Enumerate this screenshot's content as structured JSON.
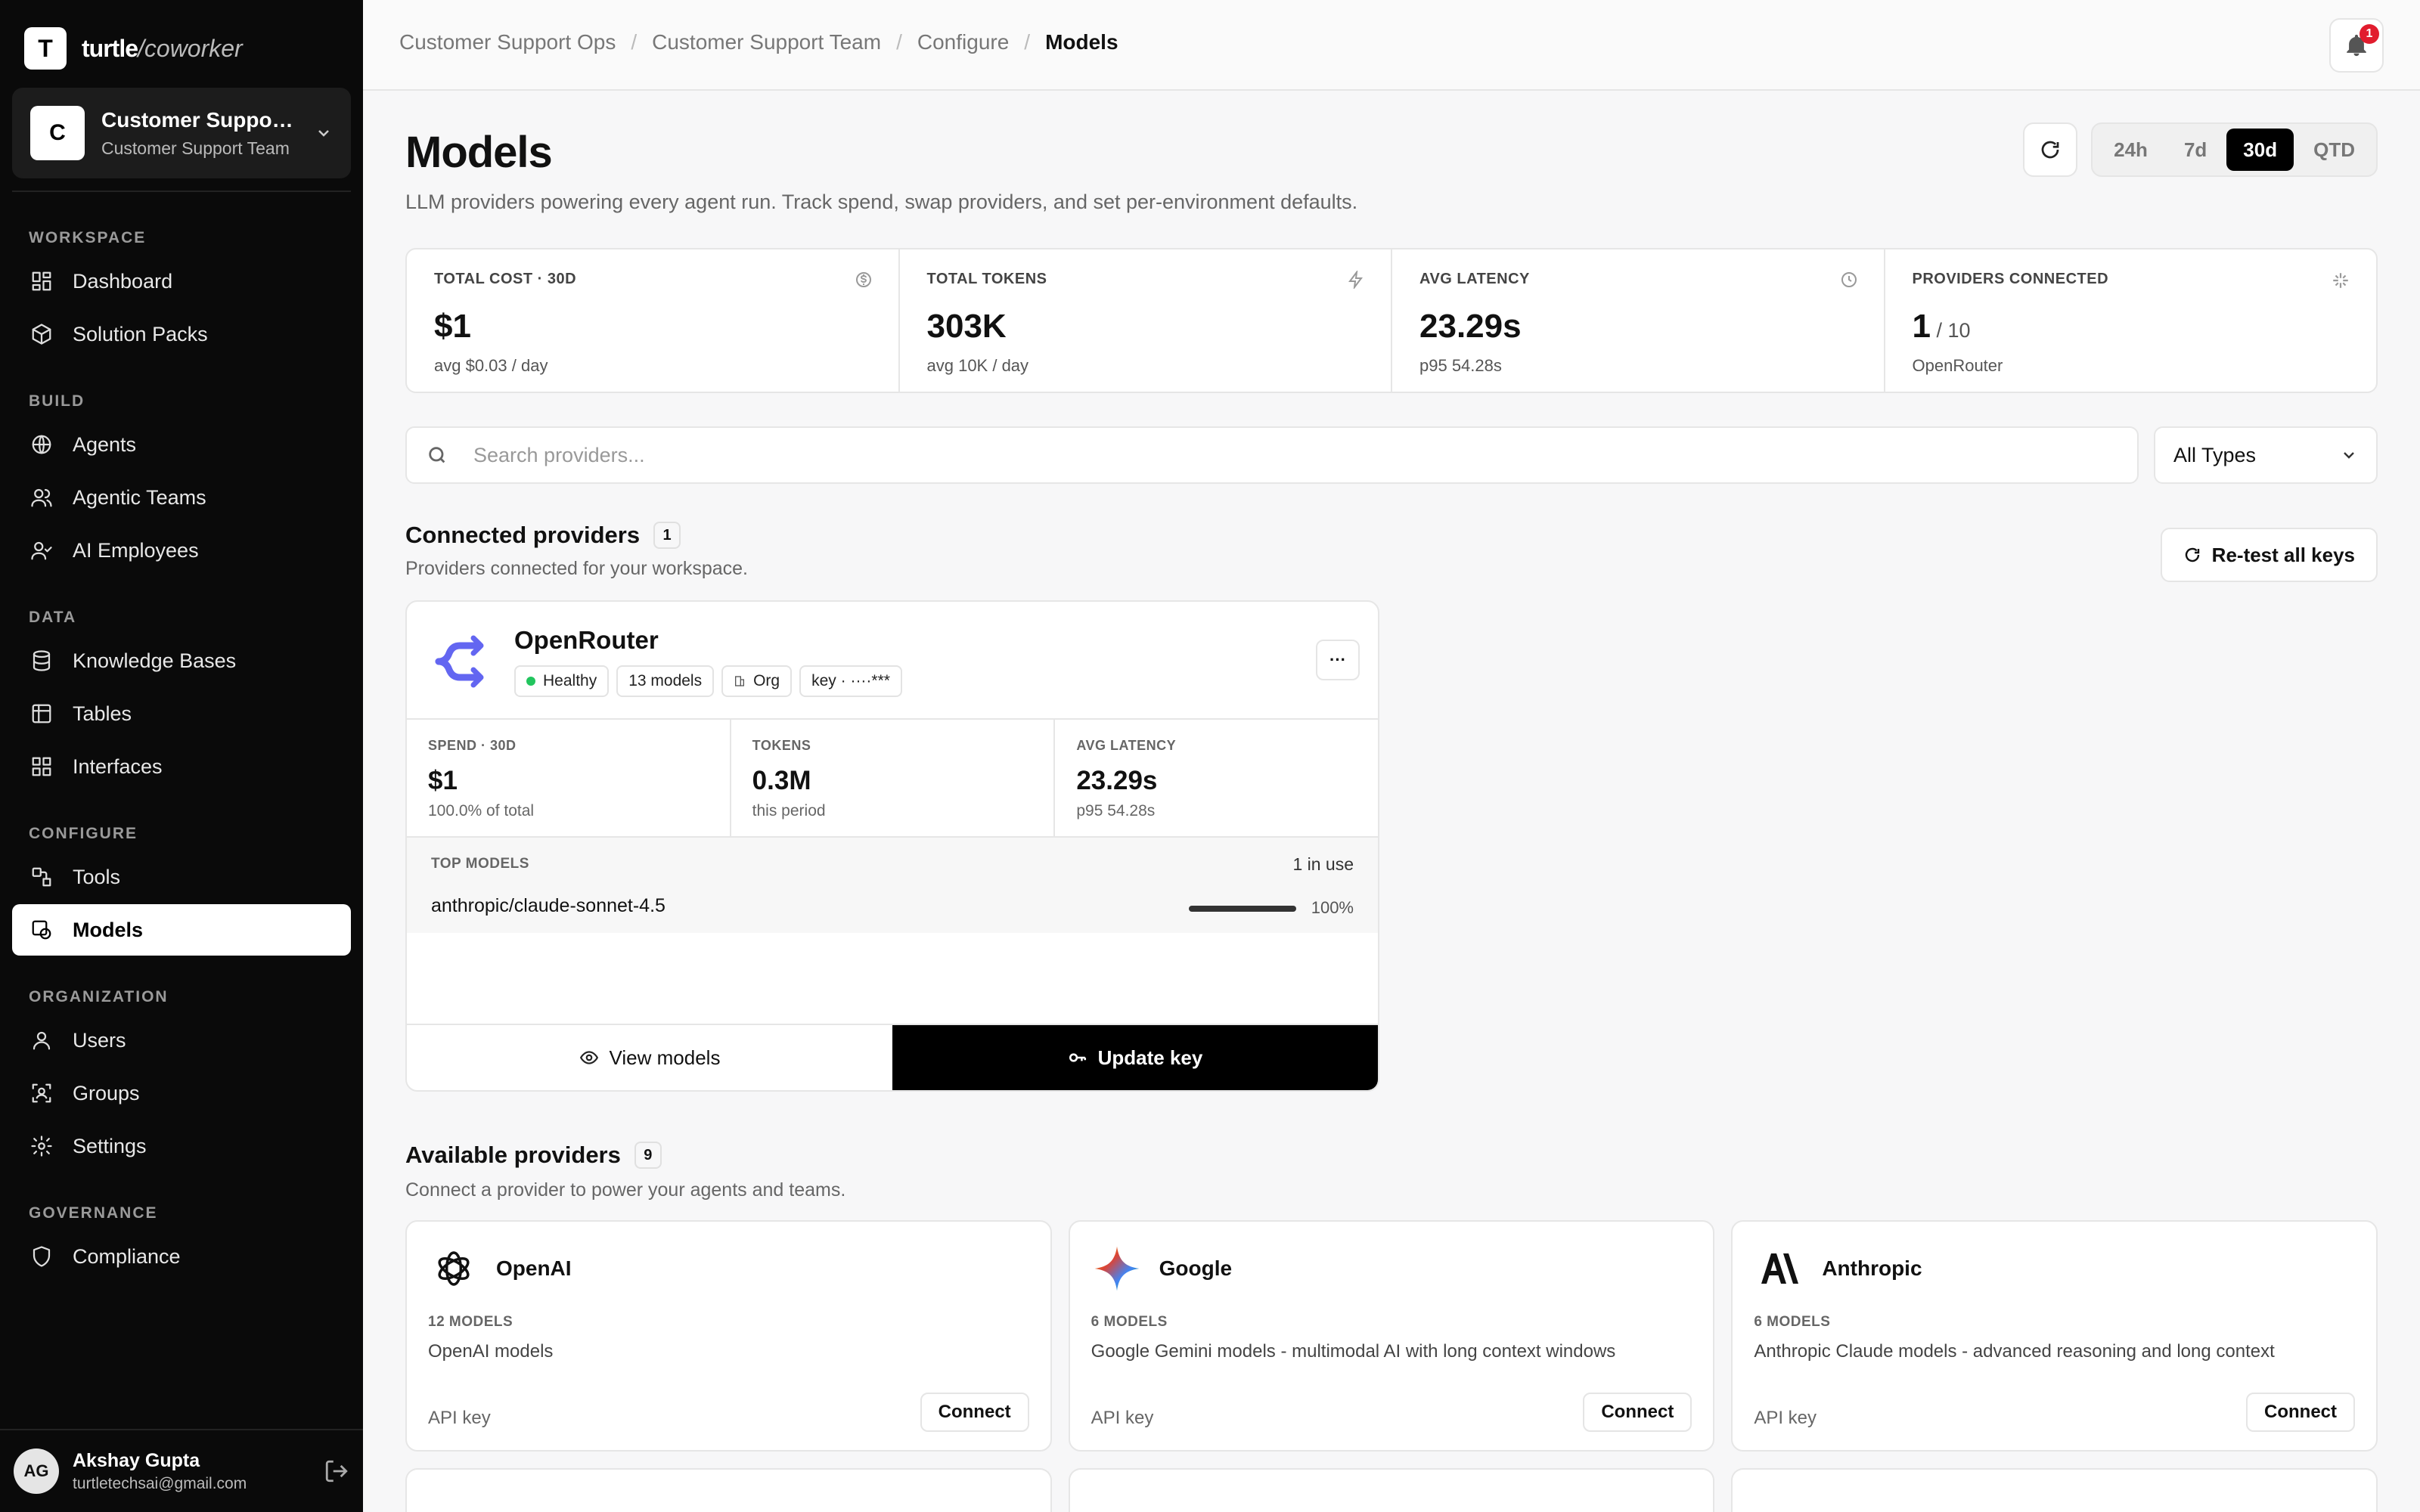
{
  "brand": {
    "name": "turtle",
    "suffix": "/coworker",
    "logo_letter": "T"
  },
  "workspace": {
    "initial": "C",
    "name": "Customer Support...",
    "team": "Customer Support Team"
  },
  "nav": {
    "sections": [
      {
        "label": "WORKSPACE",
        "items": [
          {
            "label": "Dashboard",
            "icon": "dashboard-icon"
          },
          {
            "label": "Solution Packs",
            "icon": "package-icon"
          }
        ]
      },
      {
        "label": "BUILD",
        "items": [
          {
            "label": "Agents",
            "icon": "globe-icon"
          },
          {
            "label": "Agentic Teams",
            "icon": "users-icon"
          },
          {
            "label": "AI Employees",
            "icon": "user-check-icon"
          }
        ]
      },
      {
        "label": "DATA",
        "items": [
          {
            "label": "Knowledge Bases",
            "icon": "database-icon"
          },
          {
            "label": "Tables",
            "icon": "table-icon"
          },
          {
            "label": "Interfaces",
            "icon": "layout-icon"
          }
        ]
      },
      {
        "label": "CONFIGURE",
        "items": [
          {
            "label": "Tools",
            "icon": "tools-icon"
          },
          {
            "label": "Models",
            "icon": "models-icon",
            "active": true
          }
        ]
      },
      {
        "label": "ORGANIZATION",
        "items": [
          {
            "label": "Users",
            "icon": "user-icon"
          },
          {
            "label": "Groups",
            "icon": "groups-icon"
          },
          {
            "label": "Settings",
            "icon": "gear-icon"
          }
        ]
      },
      {
        "label": "GOVERNANCE",
        "items": [
          {
            "label": "Compliance",
            "icon": "shield-icon"
          }
        ]
      }
    ]
  },
  "user": {
    "initials": "AG",
    "name": "Akshay Gupta",
    "email": "turtletechsai@gmail.com"
  },
  "breadcrumb": {
    "items": [
      "Customer Support Ops",
      "Customer Support Team",
      "Configure"
    ],
    "current": "Models"
  },
  "notifications": {
    "count": "1"
  },
  "page": {
    "title": "Models",
    "subtitle": "LLM providers powering every agent run. Track spend, swap providers, and set per-environment defaults."
  },
  "range": {
    "options": [
      "24h",
      "7d",
      "30d",
      "QTD"
    ],
    "selected": "30d"
  },
  "stats": [
    {
      "label": "TOTAL COST · 30D",
      "value": "$1",
      "suffix": "",
      "sub": "avg $0.03 / day",
      "icon": "dollar-icon"
    },
    {
      "label": "TOTAL TOKENS",
      "value": "303K",
      "suffix": "",
      "sub": "avg 10K / day",
      "icon": "bolt-icon"
    },
    {
      "label": "AVG LATENCY",
      "value": "23.29s",
      "suffix": "",
      "sub": "p95 54.28s",
      "icon": "clock-icon"
    },
    {
      "label": "PROVIDERS CONNECTED",
      "value": "1",
      "suffix": " / 10",
      "sub": "OpenRouter",
      "icon": "sparkle-icon"
    }
  ],
  "search": {
    "placeholder": "Search providers...",
    "value": ""
  },
  "type_filter": {
    "value": "All Types"
  },
  "connected": {
    "title": "Connected providers",
    "count": "1",
    "subtitle": "Providers connected for your workspace.",
    "retest_label": "Re-test all keys",
    "provider": {
      "name": "OpenRouter",
      "status": "Healthy",
      "models": "13 models",
      "scope": "Org",
      "key": "key · ····***",
      "metrics": [
        {
          "label": "SPEND · 30D",
          "value": "$1",
          "sub": "100.0% of total"
        },
        {
          "label": "TOKENS",
          "value": "0.3M",
          "sub": "this period"
        },
        {
          "label": "AVG LATENCY",
          "value": "23.29s",
          "sub": "p95 54.28s"
        }
      ],
      "top_models_label": "TOP MODELS",
      "in_use": "1 in use",
      "top_model": {
        "name": "anthropic/claude-sonnet-4.5",
        "share": 100,
        "share_label": "100%"
      },
      "view_label": "View models",
      "update_label": "Update key"
    }
  },
  "available": {
    "title": "Available providers",
    "count": "9",
    "subtitle": "Connect a provider to power your agents and teams.",
    "providers": [
      {
        "name": "OpenAI",
        "count": "12 MODELS",
        "desc": "OpenAI models",
        "key": "API key",
        "connect": "Connect",
        "icon": "openai-icon"
      },
      {
        "name": "Google",
        "count": "6 MODELS",
        "desc": "Google Gemini models - multimodal AI with long context windows",
        "key": "API key",
        "connect": "Connect",
        "icon": "gemini-icon"
      },
      {
        "name": "Anthropic",
        "count": "6 MODELS",
        "desc": "Anthropic Claude models - advanced reasoning and long context",
        "key": "API key",
        "connect": "Connect",
        "icon": "anthropic-icon"
      }
    ]
  }
}
